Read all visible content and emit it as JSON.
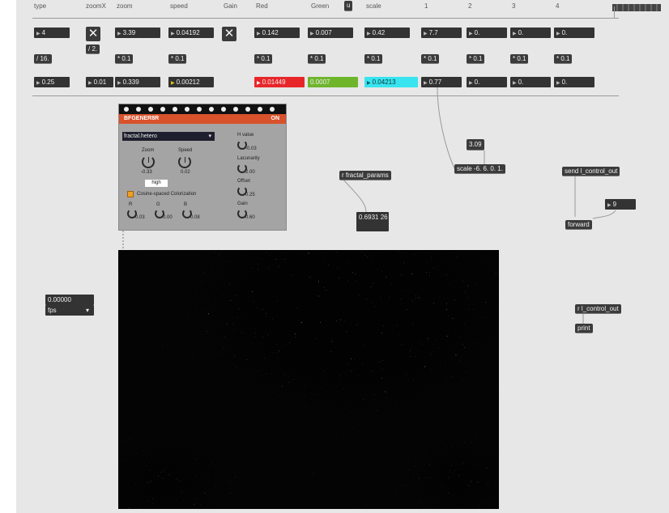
{
  "header_labels": [
    "type",
    "zoomX",
    "zoom",
    "speed",
    "Gain",
    "Red",
    "Green",
    "scale",
    "1",
    "2",
    "3",
    "4"
  ],
  "header_button": "u",
  "row1": [
    "4",
    "3.39",
    "0.04192",
    "0.142",
    "0.007",
    "0.42",
    "7.7",
    "0.",
    "0.",
    "0."
  ],
  "row2": [
    "/ 16.",
    "/ 2.",
    "* 0.1",
    "* 0.1",
    "* 0.1",
    "* 0.1",
    "* 0.1",
    "* 0.1",
    "* 0.1",
    "* 0.1",
    "* 0.1"
  ],
  "row3": [
    "0.25",
    "0.01",
    "0.339",
    "0.00212",
    "0.01449",
    "0.0007",
    "0.04213",
    "0.77",
    "0.",
    "0.",
    "0."
  ],
  "colors": {
    "red": "#e8262a",
    "green": "#6fb52c",
    "cyan": "#37e4f0",
    "panel_header": "#d8522b",
    "patch_bg": "#e7e7e7"
  },
  "bfgen": {
    "name": "BFGENER8R",
    "state": "ON",
    "preset": "fractal.hetero",
    "zoom_label": "Zoom",
    "zoom_value": "-0.33",
    "speed_label": "Speed",
    "speed_value": "0.02",
    "hvalue_label": "H value",
    "hvalue_value": "-0.03",
    "lacunarity_label": "Lacunarity",
    "lacunarity_value": "2.00",
    "offset_label": "Offset",
    "offset_value": "0.25",
    "gain_label": "Gain",
    "gain_value": "0.60",
    "quality": "high",
    "colorization_label": "Cosine-spaced Colorization",
    "r_label": "R",
    "r_value": "0.03",
    "g_label": "G",
    "g_value": "0.00",
    "b_label": "B",
    "b_value": "0.08"
  },
  "objects": {
    "r_fractal": "r fractal_params",
    "frac_value": "0.6931 26",
    "msg_309": "3.09",
    "scale_obj": "scale -6. 6. 0. 1.",
    "send_obj": "send l_control_out",
    "forward": "forward",
    "num_9": "9",
    "r_control": "r l_control_out",
    "print": "print"
  },
  "fps": {
    "value": "0.00000",
    "unit": "fps"
  }
}
